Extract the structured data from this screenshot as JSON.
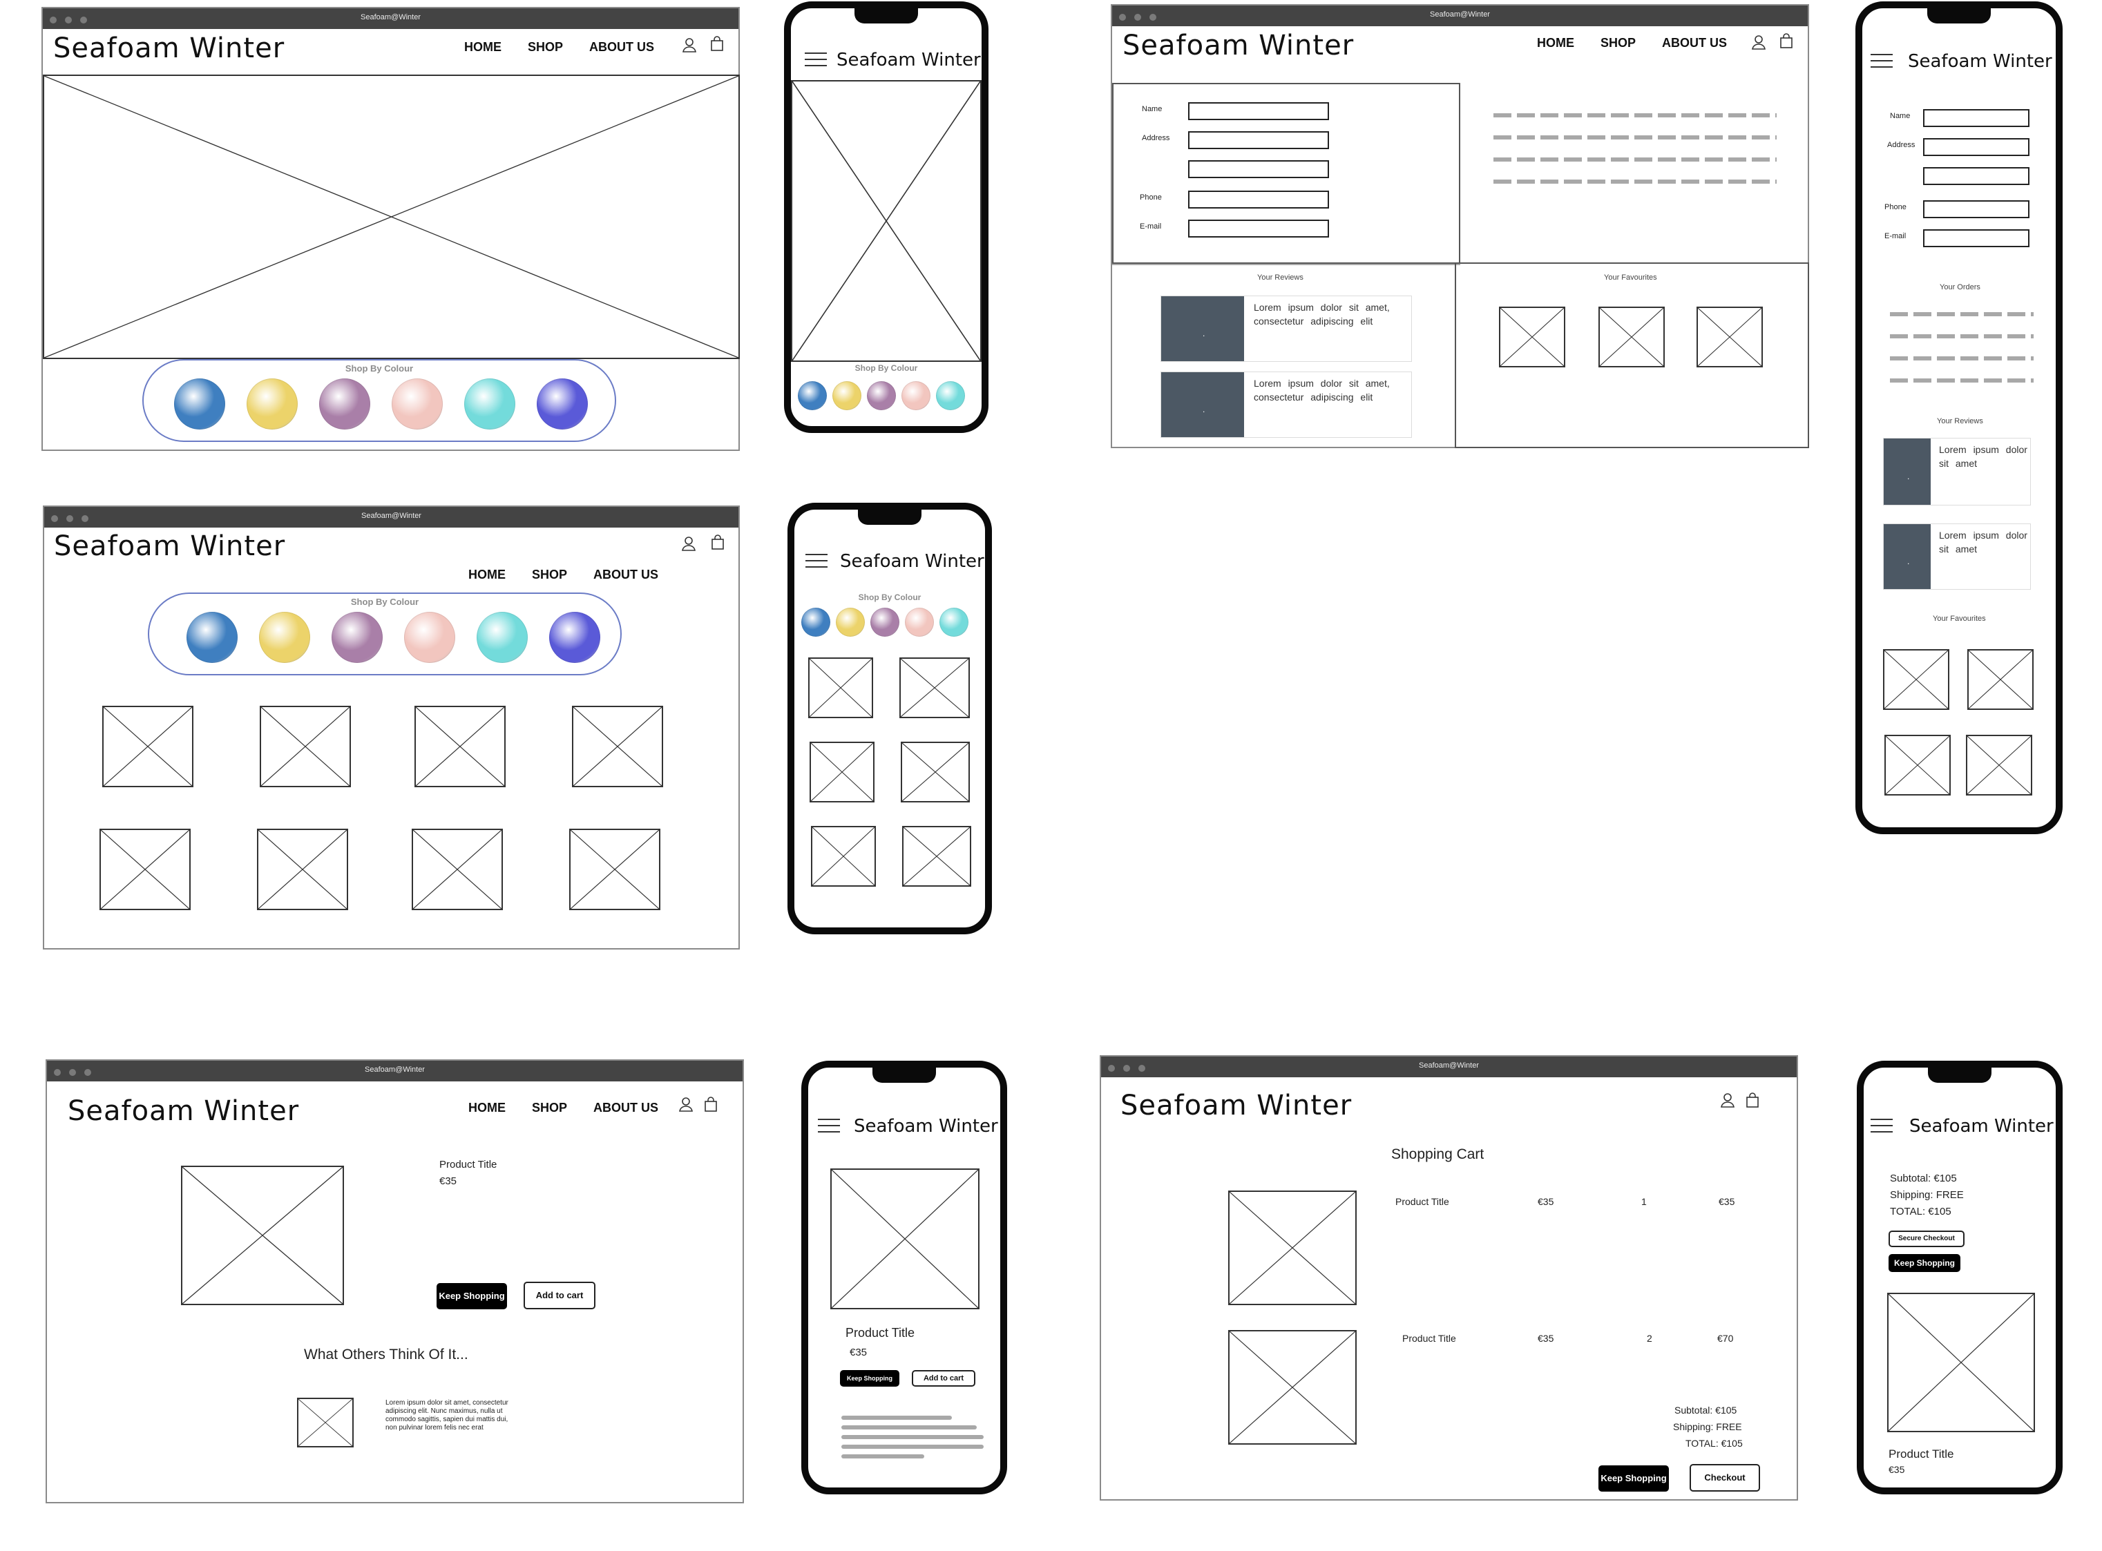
{
  "brand": "Seafoam Winter",
  "browser_title": "Seafoam@Winter",
  "nav": {
    "home": "HOME",
    "shop": "SHOP",
    "about": "ABOUT US"
  },
  "shop_by_colour": "Shop By Colour",
  "yarn_colors": [
    "#3f7fc0",
    "#ecd36a",
    "#a97fa8",
    "#f2c6bf",
    "#73dbdb",
    "#5a5ad8"
  ],
  "account": {
    "name_label": "Name",
    "address_label": "Address",
    "phone_label": "Phone",
    "email_label": "E-mail",
    "reviews_heading": "Your Reviews",
    "favourites_heading": "Your Favourites",
    "orders_heading": "Your Orders",
    "review_text": "Lorem ipsum dolor sit amet, consectetur adipiscing elit",
    "review_text_mobile": "Lorem ipsum dolor sit amet"
  },
  "product": {
    "title": "Product Title",
    "price": "€35",
    "keep_shopping": "Keep Shopping",
    "add_to_cart": "Add to cart",
    "reviews_heading": "What Others Think Of It...",
    "review_body": "Lorem ipsum dolor sit amet, consectetur adipiscing elit. Nunc maximus, nulla ut commodo sagittis, sapien dui mattis dui, non pulvinar lorem felis nec erat"
  },
  "cart": {
    "heading": "Shopping Cart",
    "items": [
      {
        "title": "Product Title",
        "price": "€35",
        "qty": "1",
        "total": "€35"
      },
      {
        "title": "Product Title",
        "price": "€35",
        "qty": "2",
        "total": "€70"
      }
    ],
    "subtotal": "Subtotal: €105",
    "shipping": "Shipping: FREE",
    "total": "TOTAL: €105",
    "keep_shopping": "Keep Shopping",
    "checkout": "Checkout",
    "secure_checkout": "Secure Checkout"
  }
}
